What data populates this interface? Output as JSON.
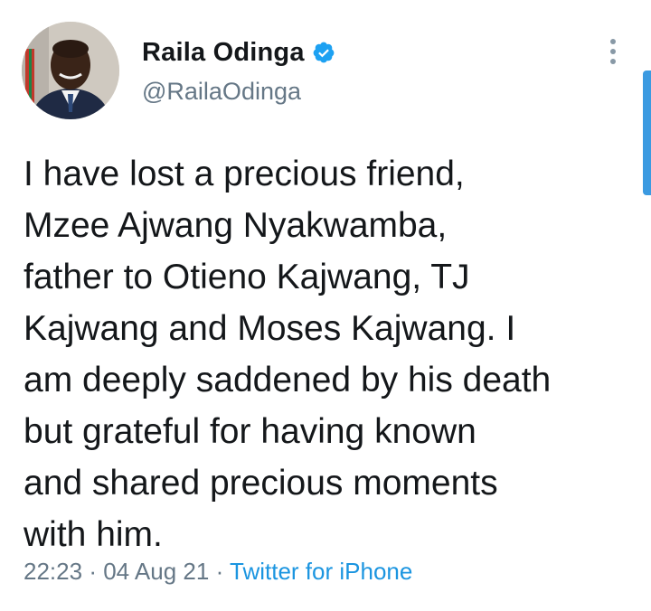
{
  "tweet": {
    "author": {
      "display_name": "Raila Odinga",
      "handle": "@RailaOdinga",
      "verified": true,
      "avatar_icon": "profile-photo"
    },
    "menu_icon": "more-vertical-icon",
    "text_lines": [
      "I have lost a precious friend,",
      "Mzee Ajwang Nyakwamba,",
      "father to Otieno Kajwang, TJ",
      "Kajwang and Moses Kajwang. I",
      "am deeply saddened by his death",
      "but grateful for having known",
      "and shared precious moments",
      "with him."
    ],
    "time": "22:23",
    "separator": "·",
    "date": "04 Aug 21",
    "source": "Twitter for iPhone"
  },
  "colors": {
    "text": "#14171a",
    "secondary": "#657786",
    "accent": "#1b95e0",
    "verified_badge": "#1da1f2",
    "scrollbar": "#3b9ae1"
  }
}
